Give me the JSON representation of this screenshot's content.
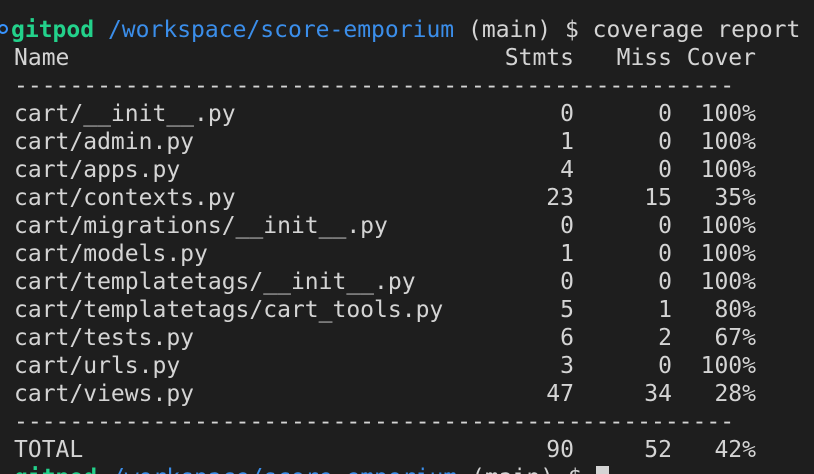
{
  "prompt": {
    "user": "gitpod",
    "path": "/workspace/score-emporium",
    "branch": "(main)",
    "symbol": "$",
    "command": "coverage report"
  },
  "header": {
    "name": "Name",
    "stmts": "Stmts",
    "miss": "Miss",
    "cover": "Cover"
  },
  "divider": "----------------------------------------------------",
  "rows": [
    {
      "name": "cart/__init__.py",
      "stmts": "0",
      "miss": "0",
      "cover": "100%"
    },
    {
      "name": "cart/admin.py",
      "stmts": "1",
      "miss": "0",
      "cover": "100%"
    },
    {
      "name": "cart/apps.py",
      "stmts": "4",
      "miss": "0",
      "cover": "100%"
    },
    {
      "name": "cart/contexts.py",
      "stmts": "23",
      "miss": "15",
      "cover": "35%"
    },
    {
      "name": "cart/migrations/__init__.py",
      "stmts": "0",
      "miss": "0",
      "cover": "100%"
    },
    {
      "name": "cart/models.py",
      "stmts": "1",
      "miss": "0",
      "cover": "100%"
    },
    {
      "name": "cart/templatetags/__init__.py",
      "stmts": "0",
      "miss": "0",
      "cover": "100%"
    },
    {
      "name": "cart/templatetags/cart_tools.py",
      "stmts": "5",
      "miss": "1",
      "cover": "80%"
    },
    {
      "name": "cart/tests.py",
      "stmts": "6",
      "miss": "2",
      "cover": "67%"
    },
    {
      "name": "cart/urls.py",
      "stmts": "3",
      "miss": "0",
      "cover": "100%"
    },
    {
      "name": "cart/views.py",
      "stmts": "47",
      "miss": "34",
      "cover": "28%"
    }
  ],
  "total": {
    "name": "TOTAL",
    "stmts": "90",
    "miss": "52",
    "cover": "42%"
  },
  "next_prompt": {
    "user": "gitpod",
    "path": "/workspace/score-emporium",
    "branch": "(main)",
    "symbol": "$"
  }
}
